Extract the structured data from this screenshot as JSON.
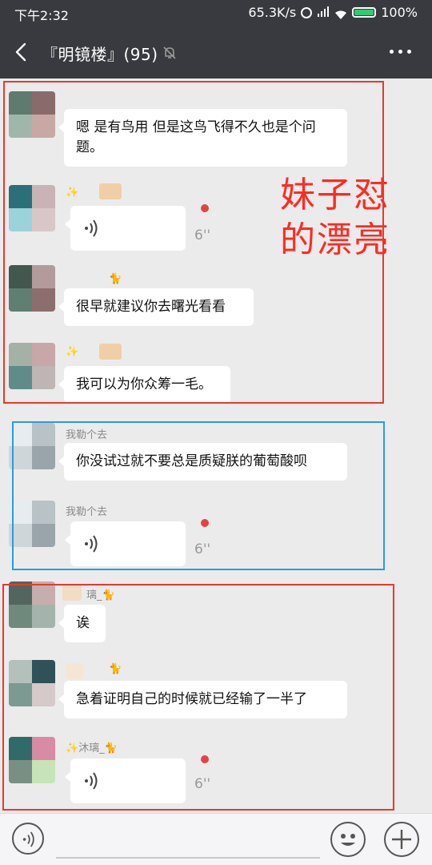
{
  "status_bar": {
    "time": "下午2:32",
    "speed": "65.3K/s",
    "battery": "100%"
  },
  "nav": {
    "title": "『明镜楼』(95)"
  },
  "messages": [
    {
      "type": "text",
      "nickname": "",
      "text": "嗯 是有鸟用 但是这鸟飞得不久也是个问题。"
    },
    {
      "type": "voice",
      "nickname": "✨",
      "duration": "6''",
      "unread": true
    },
    {
      "type": "text",
      "nickname": "🐈",
      "text": "很早就建议你去曙光看看"
    },
    {
      "type": "text",
      "nickname": "✨",
      "text": "我可以为你众筹一毛。"
    },
    {
      "type": "text",
      "nickname": "我勒个去",
      "text": "你没试过就不要总是质疑朕的葡萄酸呗"
    },
    {
      "type": "voice",
      "nickname": "我勒个去",
      "duration": "6''",
      "unread": true
    },
    {
      "type": "text",
      "nickname": "璃_🐈",
      "text": "诶"
    },
    {
      "type": "text",
      "nickname": "🐈",
      "text": "急着证明自己的时候就已经输了一半了"
    },
    {
      "type": "voice",
      "nickname": "✨沐璃_🐈",
      "duration": "6''",
      "unread": true
    }
  ],
  "annotation": {
    "line1": "妹子怼",
    "line2": "的漂亮",
    "color": "#ff2b22"
  },
  "colors": {
    "header": "#393a3f",
    "chat_bg": "#ebebeb",
    "red_box": "#e8392f",
    "blue_box": "#2b9be0",
    "unread_dot": "#e64340"
  },
  "icons": {
    "back": "chevron-left-icon",
    "mute": "mute-bell-icon",
    "more": "more-dots-icon",
    "voice": "voice-wave-icon",
    "emoji": "emoji-face-icon",
    "plus": "plus-icon"
  }
}
